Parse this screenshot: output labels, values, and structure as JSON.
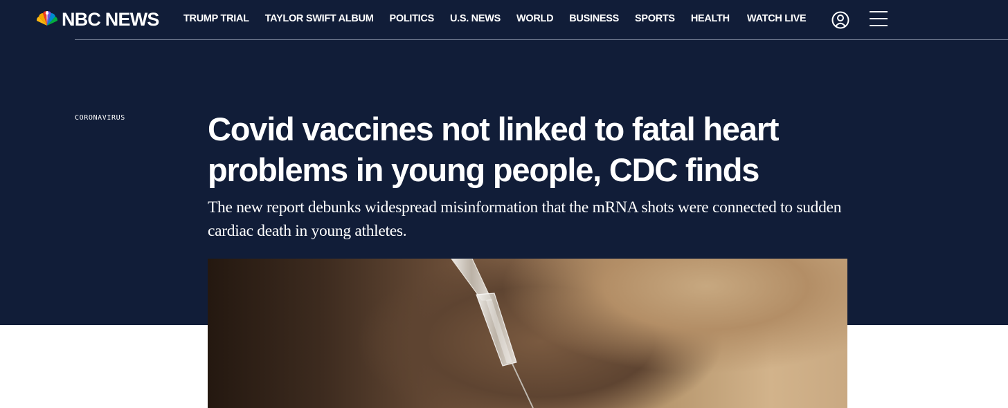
{
  "brand": {
    "name": "NBC NEWS"
  },
  "nav": {
    "links": [
      "TRUMP TRIAL",
      "TAYLOR SWIFT ALBUM",
      "POLITICS",
      "U.S. NEWS",
      "WORLD",
      "BUSINESS",
      "SPORTS",
      "HEALTH"
    ],
    "watch_live": "WATCH LIVE",
    "icons": {
      "account": "user-circle-icon",
      "menu": "hamburger-menu-icon"
    }
  },
  "article": {
    "category": "CORONAVIRUS",
    "headline": "Covid vaccines not linked to fatal heart problems in young people, CDC finds",
    "dek": "The new report debunks widespread misinformation that the mRNA shots were connected to sudden cardiac death in young athletes."
  },
  "colors": {
    "header_bg": "#111d38",
    "page_bg": "#ffffff",
    "text": "#ffffff"
  }
}
